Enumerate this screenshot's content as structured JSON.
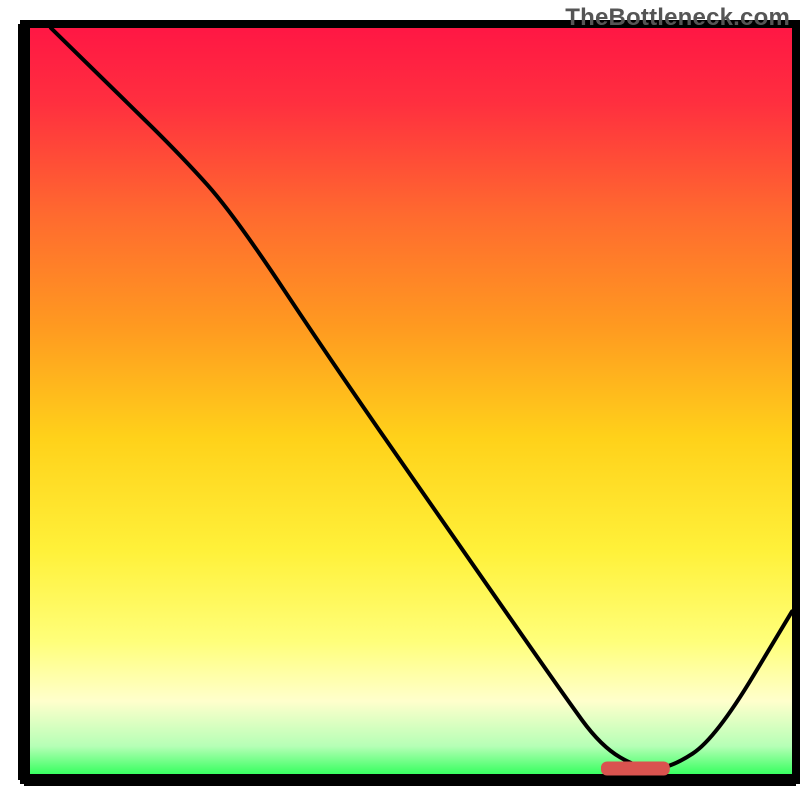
{
  "watermark": "TheBottleneck.com",
  "chart_data": {
    "type": "line",
    "title": "",
    "xlabel": "",
    "ylabel": "",
    "xlim": [
      0,
      100
    ],
    "ylim": [
      0,
      100
    ],
    "grid": false,
    "legend": false,
    "background_gradient": {
      "stops": [
        {
          "offset": 0.0,
          "color": "#ff1744"
        },
        {
          "offset": 0.1,
          "color": "#ff2f3f"
        },
        {
          "offset": 0.25,
          "color": "#ff6a2f"
        },
        {
          "offset": 0.4,
          "color": "#ff9a20"
        },
        {
          "offset": 0.55,
          "color": "#ffd21a"
        },
        {
          "offset": 0.7,
          "color": "#fff13a"
        },
        {
          "offset": 0.82,
          "color": "#ffff7a"
        },
        {
          "offset": 0.9,
          "color": "#ffffcc"
        },
        {
          "offset": 0.96,
          "color": "#b6ffb6"
        },
        {
          "offset": 1.0,
          "color": "#2fff5a"
        }
      ]
    },
    "axis_box": {
      "x0": 3,
      "y0": 3,
      "x1": 100,
      "y1": 100
    },
    "series": [
      {
        "name": "bottleneck-curve",
        "type": "line",
        "x": [
          3,
          10,
          20,
          27,
          40,
          55,
          70,
          75,
          80,
          84,
          90,
          100
        ],
        "y": [
          100,
          93,
          83,
          75,
          55,
          33,
          11,
          4,
          1,
          1,
          5,
          22
        ]
      }
    ],
    "markers": [
      {
        "name": "optimal-marker",
        "shape": "rounded-bar",
        "x_start": 75,
        "x_end": 84,
        "y": 1,
        "color": "#d9534f"
      }
    ]
  }
}
